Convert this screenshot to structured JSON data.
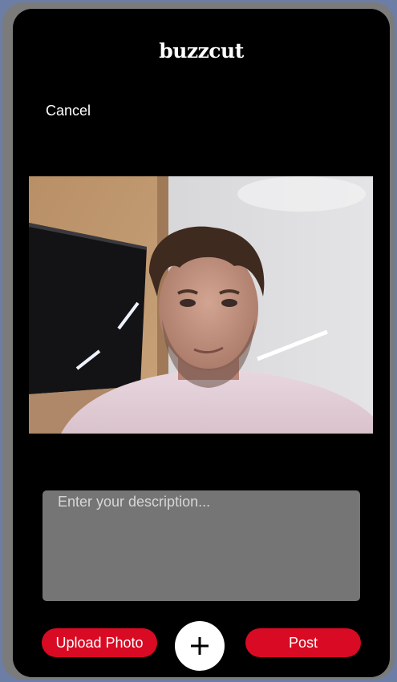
{
  "app": {
    "title": "buzzcut"
  },
  "header": {
    "cancel_label": "Cancel"
  },
  "photo": {
    "icon": "camera-capture"
  },
  "description": {
    "placeholder": "Enter your description...",
    "value": ""
  },
  "actions": {
    "upload_label": "Upload Photo",
    "add_icon": "plus-icon",
    "post_label": "Post"
  },
  "colors": {
    "background": "#000000",
    "accent": "#d90a23",
    "input_bg": "#757575",
    "frame": "#7b7b7b"
  }
}
